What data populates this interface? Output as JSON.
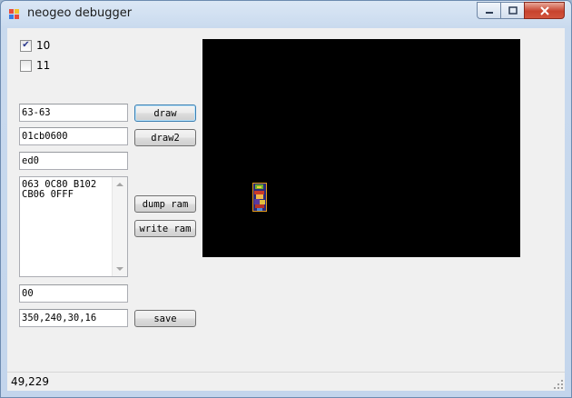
{
  "window": {
    "title": "neogeo debugger",
    "title_icon": "app-icon",
    "caption_buttons": [
      "minimize-icon",
      "maximize-icon",
      "close-icon"
    ]
  },
  "checkboxes": [
    {
      "label": "10",
      "checked": true
    },
    {
      "label": "11",
      "checked": false
    }
  ],
  "inputs": {
    "range": "63-63",
    "address": "01cb0600",
    "value": "ed0",
    "memo": "063 0C80 B102\nCB06 0FFF",
    "byte": "00",
    "rect": "350,240,30,16"
  },
  "buttons": {
    "draw": "draw",
    "draw2": "draw2",
    "dump_ram": "dump ram",
    "write_ram": "write ram",
    "save": "save"
  },
  "canvas": {
    "background": "#000000"
  },
  "status": {
    "coords": "49,229"
  },
  "colors": {
    "accent_focus": "#3c7fb1",
    "close_button": "#c7432e"
  }
}
